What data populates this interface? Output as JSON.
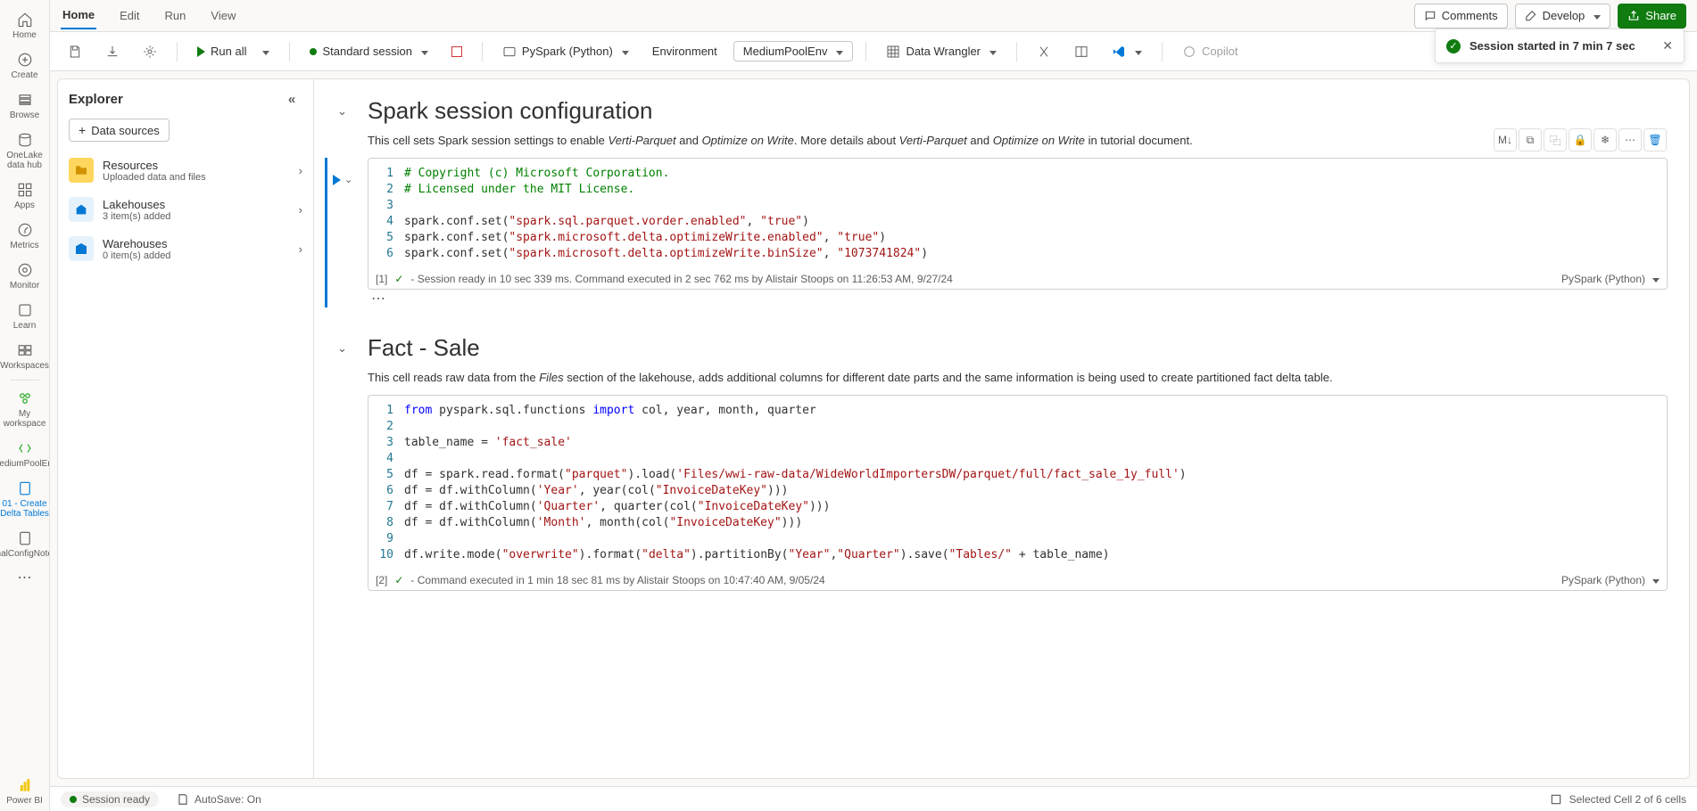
{
  "tabs": {
    "home": "Home",
    "edit": "Edit",
    "run": "Run",
    "view": "View"
  },
  "topright": {
    "comments": "Comments",
    "develop": "Develop",
    "share": "Share"
  },
  "toolbar": {
    "runall": "Run all",
    "session": "Standard session",
    "lang": "PySpark (Python)",
    "env_label": "Environment",
    "env_value": "MediumPoolEnv",
    "wrangler": "Data Wrangler",
    "copilot": "Copilot"
  },
  "toast": {
    "msg": "Session started in 7 min 7 sec"
  },
  "rail": {
    "home": "Home",
    "create": "Create",
    "browse": "Browse",
    "onelake": "OneLake data hub",
    "apps": "Apps",
    "metrics": "Metrics",
    "monitor": "Monitor",
    "learn": "Learn",
    "workspaces": "Workspaces",
    "myws": "My workspace",
    "mpool": "MediumPoolEnv",
    "nb1": "01 - Create Delta Tables",
    "nb2": "OptimalConfigNotebook",
    "powerbi": "Power BI"
  },
  "explorer": {
    "title": "Explorer",
    "datasources": "Data sources",
    "items": [
      {
        "title": "Resources",
        "sub": "Uploaded data and files",
        "icon": "folder"
      },
      {
        "title": "Lakehouses",
        "sub": "3 item(s) added",
        "icon": "lake"
      },
      {
        "title": "Warehouses",
        "sub": "0 item(s) added",
        "icon": "wh"
      }
    ]
  },
  "cells": {
    "md1": {
      "title": "Spark session configuration",
      "body_a": "This cell sets Spark session settings to enable ",
      "vp": "Verti-Parquet",
      "and": " and ",
      "ow": "Optimize on Write",
      "body_b": ". More details about ",
      "body_c": " in tutorial document."
    },
    "code1": {
      "idx": "[1]",
      "status": "- Session ready in 10 sec 339 ms. Command executed in 2 sec 762 ms by Alistair Stoops on 11:26:53 AM, 9/27/24",
      "lang": "PySpark (Python)",
      "lines": [
        "1",
        "2",
        "3",
        "4",
        "5",
        "6"
      ],
      "l1": "# Copyright (c) Microsoft Corporation.",
      "l2": "# Licensed under the MIT License.",
      "l4a": "spark.conf.set(",
      "l4s": "\"spark.sql.parquet.vorder.enabled\"",
      "l4c": ", ",
      "l4v": "\"true\"",
      "l4e": ")",
      "l5a": "spark.conf.set(",
      "l5s": "\"spark.microsoft.delta.optimizeWrite.enabled\"",
      "l5c": ", ",
      "l5v": "\"true\"",
      "l5e": ")",
      "l6a": "spark.conf.set(",
      "l6s": "\"spark.microsoft.delta.optimizeWrite.binSize\"",
      "l6c": ", ",
      "l6v": "\"1073741824\"",
      "l6e": ")"
    },
    "md2": {
      "title": "Fact - Sale",
      "body_a": "This cell reads raw data from the ",
      "files": "Files",
      "body_b": " section of the lakehouse, adds additional columns for different date parts and the same information is being used to create partitioned fact delta table."
    },
    "code2": {
      "idx": "[2]",
      "status": "- Command executed in 1 min 18 sec 81 ms by Alistair Stoops on 10:47:40 AM, 9/05/24",
      "lang": "PySpark (Python)",
      "lines": [
        "1",
        "2",
        "3",
        "4",
        "5",
        "6",
        "7",
        "8",
        "9",
        "10"
      ],
      "l1a": "from",
      "l1b": " pyspark.sql.functions ",
      "l1c": "import",
      "l1d": " col, year, month, quarter",
      "l3a": "table_name = ",
      "l3b": "'fact_sale'",
      "l5a": "df = spark.read.format(",
      "l5b": "\"parquet\"",
      "l5c": ").load(",
      "l5d": "'Files/wwi-raw-data/WideWorldImportersDW/parquet/full/fact_sale_1y_full'",
      "l5e": ")",
      "l6a": "df = df.withColumn(",
      "l6b": "'Year'",
      "l6c": ", year(col(",
      "l6d": "\"InvoiceDateKey\"",
      "l6e": ")))",
      "l7a": "df = df.withColumn(",
      "l7b": "'Quarter'",
      "l7c": ", quarter(col(",
      "l7d": "\"InvoiceDateKey\"",
      "l7e": ")))",
      "l8a": "df = df.withColumn(",
      "l8b": "'Month'",
      "l8c": ", month(col(",
      "l8d": "\"InvoiceDateKey\"",
      "l8e": ")))",
      "l10a": "df.write.mode(",
      "l10b": "\"overwrite\"",
      "l10c": ").format(",
      "l10d": "\"delta\"",
      "l10e": ").partitionBy(",
      "l10f": "\"Year\"",
      "l10g": ",",
      "l10h": "\"Quarter\"",
      "l10i": ").save(",
      "l10j": "\"Tables/\"",
      "l10k": " + table_name)"
    }
  },
  "statusbar": {
    "session": "Session ready",
    "autosave": "AutoSave: On",
    "cellinfo": "Selected Cell 2 of 6 cells"
  },
  "cell_toolbar": {
    "md": "M↓"
  }
}
